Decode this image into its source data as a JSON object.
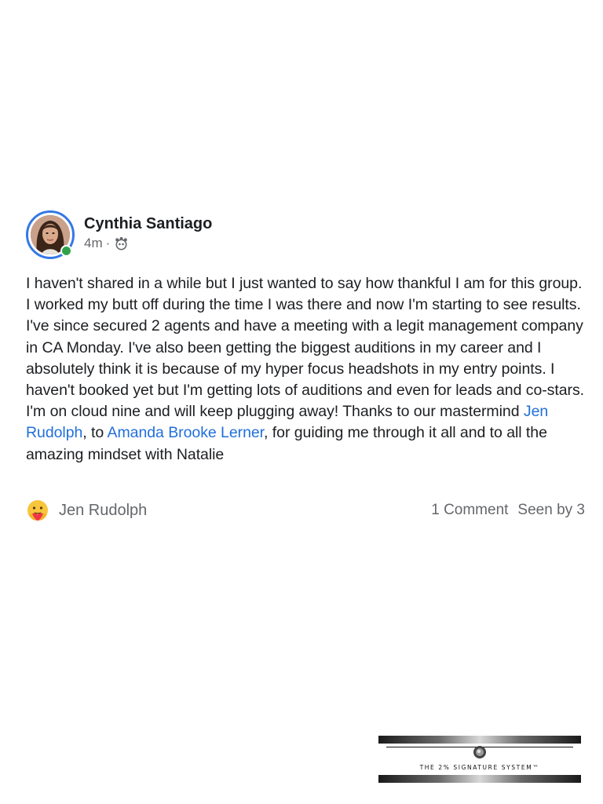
{
  "post": {
    "author": "Cynthia Santiago",
    "timestamp": "4m",
    "separator": "·",
    "audience_icon": "group-audience-icon",
    "body": {
      "text_1": "I haven't shared in a while but I just wanted to say how thankful I am for this group. I worked my butt off during the time I was there and now I'm starting to see results. I've since secured 2 agents and have a meeting with a legit management company in CA Monday. I've also been getting the biggest auditions in my career and I absolutely think it is because of my hyper focus headshots in my entry points. I haven't booked yet but I'm getting lots of auditions and even for leads and co-stars. I'm on cloud nine and will keep plugging away! Thanks to our mastermind ",
      "mention_1": "Jen Rudolph",
      "text_2": ", to ",
      "mention_2": "Amanda Brooke Lerner",
      "text_3": ", for guiding me through it all and to all the amazing mindset with Natalie"
    },
    "reaction": {
      "icon": "care-reaction-icon",
      "reactor": "Jen Rudolph"
    },
    "comments": "1 Comment",
    "seen_by": "Seen by 3"
  },
  "colors": {
    "mention": "#216fdb",
    "online": "#31a24c",
    "ring": "#3578e5",
    "muted": "#65676b"
  },
  "logo": {
    "text": "THE 2% SIGNATURE SYSTEM™"
  }
}
